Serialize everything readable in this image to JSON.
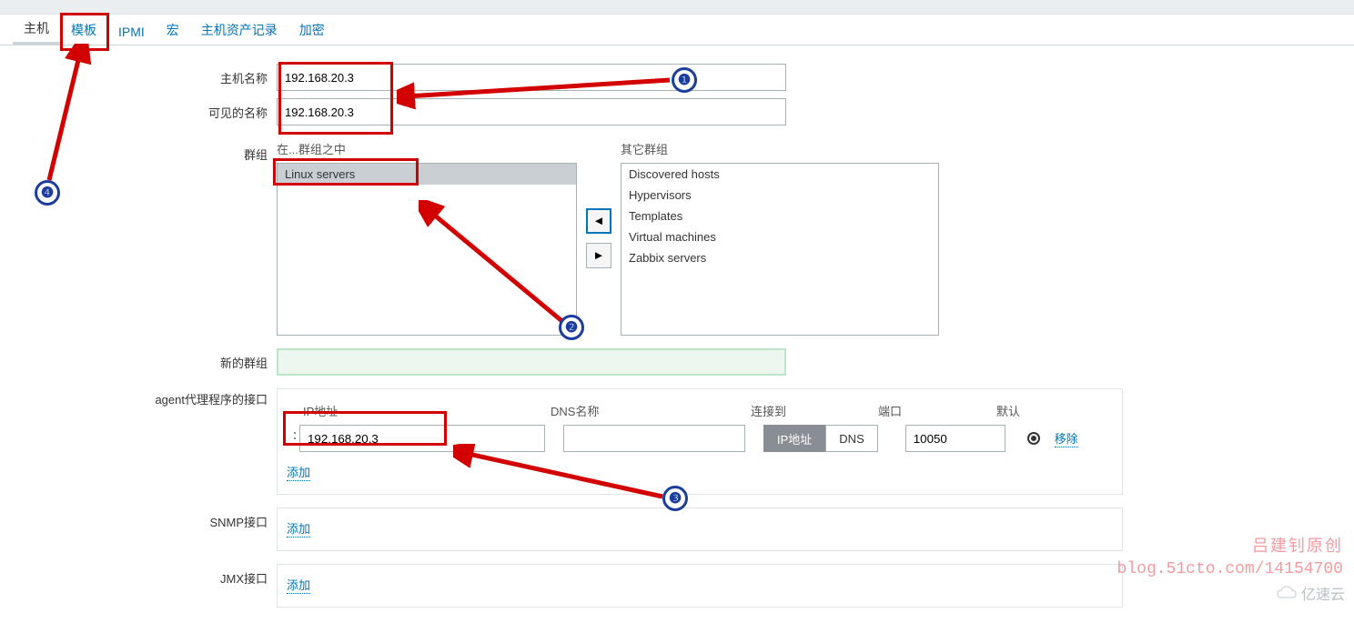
{
  "tabs": {
    "host": "主机",
    "templates": "模板",
    "ipmi": "IPMI",
    "macros": "宏",
    "inventory": "主机资产记录",
    "encryption": "加密"
  },
  "labels": {
    "host_name": "主机名称",
    "visible_name": "可见的名称",
    "groups": "群组",
    "in_groups": "在...群组之中",
    "other_groups": "其它群组",
    "new_group": "新的群组",
    "agent_interfaces": "agent代理程序的接口",
    "ip_address": "IP地址",
    "dns_name": "DNS名称",
    "connect_to": "连接到",
    "port": "端口",
    "default": "默认",
    "remove": "移除",
    "add": "添加",
    "snmp_interfaces": "SNMP接口",
    "jmx_interfaces": "JMX接口",
    "connect_ip": "IP地址",
    "connect_dns": "DNS"
  },
  "values": {
    "host_name": "192.168.20.3",
    "visible_name": "192.168.20.3",
    "agent_ip": "192.168.20.3",
    "agent_dns": "",
    "agent_port": "10050",
    "new_group": ""
  },
  "groups_in": [
    "Linux servers"
  ],
  "groups_other": [
    "Discovered hosts",
    "Hypervisors",
    "Templates",
    "Virtual machines",
    "Zabbix servers"
  ],
  "watermark": {
    "line1": "吕建钊原创",
    "line2": "blog.51cto.com/14154700",
    "logo": "亿速云"
  }
}
